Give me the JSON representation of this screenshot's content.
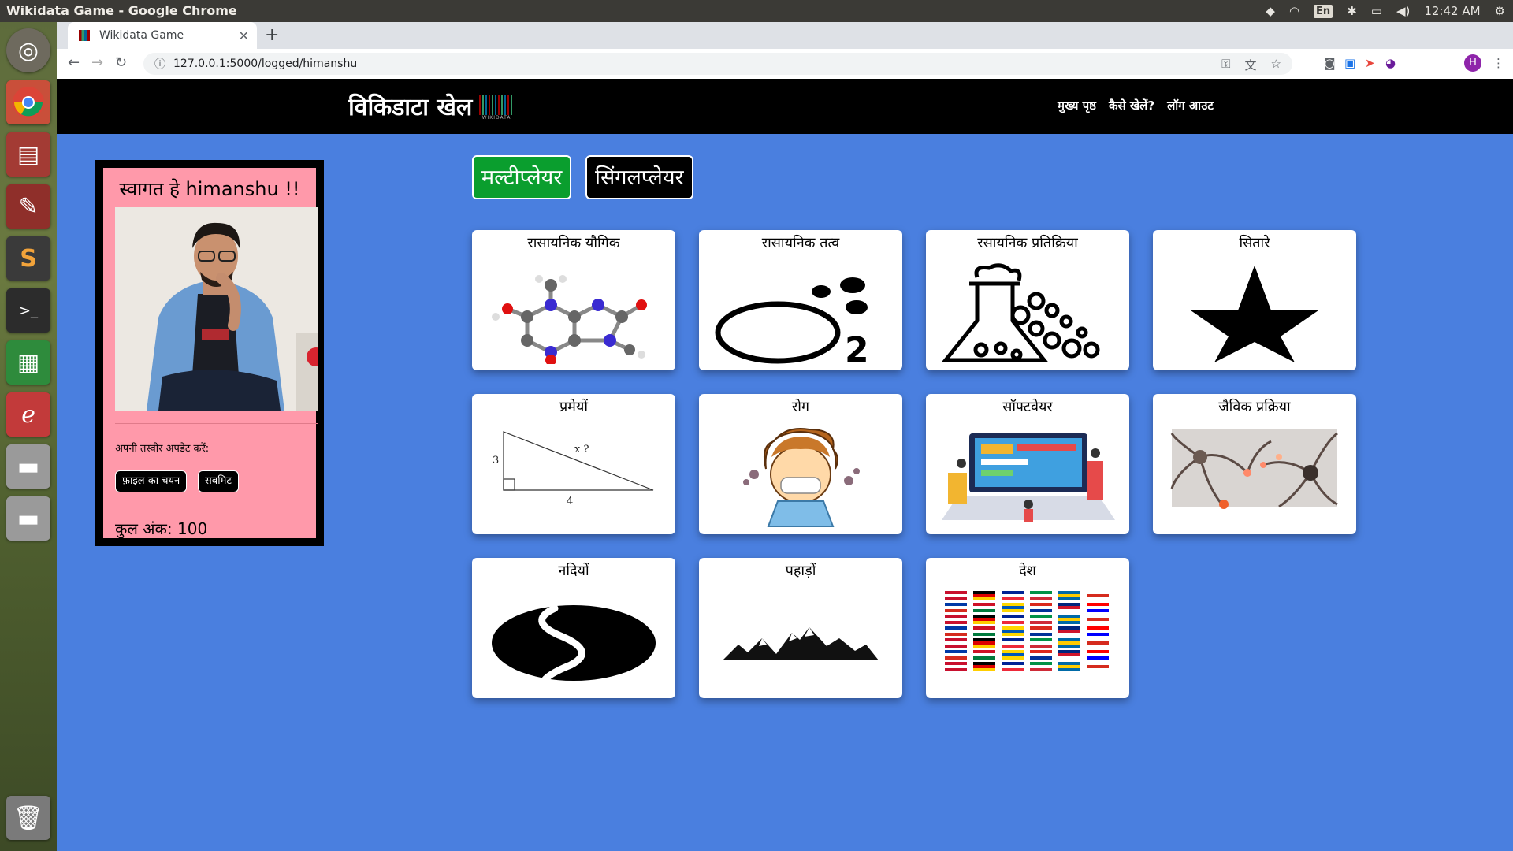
{
  "os": {
    "window_title": "Wikidata Game - Google Chrome",
    "tray": {
      "keyboard": "En",
      "time": "12:42 AM"
    }
  },
  "browser": {
    "tab_title": "Wikidata Game",
    "url": "127.0.0.1:5000/logged/himanshu",
    "profile_initial": "H"
  },
  "site": {
    "brand": "विकिडाटा खेल",
    "brand_logo_caption": "WIKIDATA",
    "nav": [
      "मुख्य पृष्ठ",
      "कैसे खेलें?",
      "लॉग आउट"
    ]
  },
  "profile": {
    "welcome": "स्वागत हे himanshu !!",
    "update_label": "अपनी तस्वीर अपडेट करें:",
    "choose_file": "फ़ाइल का चयन",
    "submit": "सबमिट",
    "score": "कुल अंक: 100"
  },
  "modes": {
    "multiplayer": "मल्टीप्लेयर",
    "singleplayer": "सिंगलप्लेयर"
  },
  "categories": [
    {
      "title": "रासायनिक यौगिक",
      "icon": "molecule-icon"
    },
    {
      "title": "रासायनिक तत्व",
      "icon": "oxygen-o2-icon"
    },
    {
      "title": "रसायनिक प्रतिक्रिया",
      "icon": "flask-icon"
    },
    {
      "title": "सितारे",
      "icon": "star-icon"
    },
    {
      "title": "प्रमेयों",
      "icon": "triangle-theorem-icon"
    },
    {
      "title": "रोग",
      "icon": "sick-child-icon"
    },
    {
      "title": "सॉफ्टवेयर",
      "icon": "software-team-icon"
    },
    {
      "title": "जैविक प्रक्रिया",
      "icon": "neurons-icon"
    },
    {
      "title": "नदियों",
      "icon": "river-icon"
    },
    {
      "title": "पहाड़ों",
      "icon": "mountains-icon"
    },
    {
      "title": "देश",
      "icon": "flags-icon"
    }
  ],
  "theorem_labels": {
    "a": "3",
    "b": "4",
    "c": "x ?"
  },
  "colors": {
    "page_bg": "#4a7fdf",
    "navbar_bg": "#000000",
    "profile_bg": "#ff99aa",
    "multiplayer_bg": "#0a9e2e",
    "singleplayer_bg": "#000000"
  }
}
